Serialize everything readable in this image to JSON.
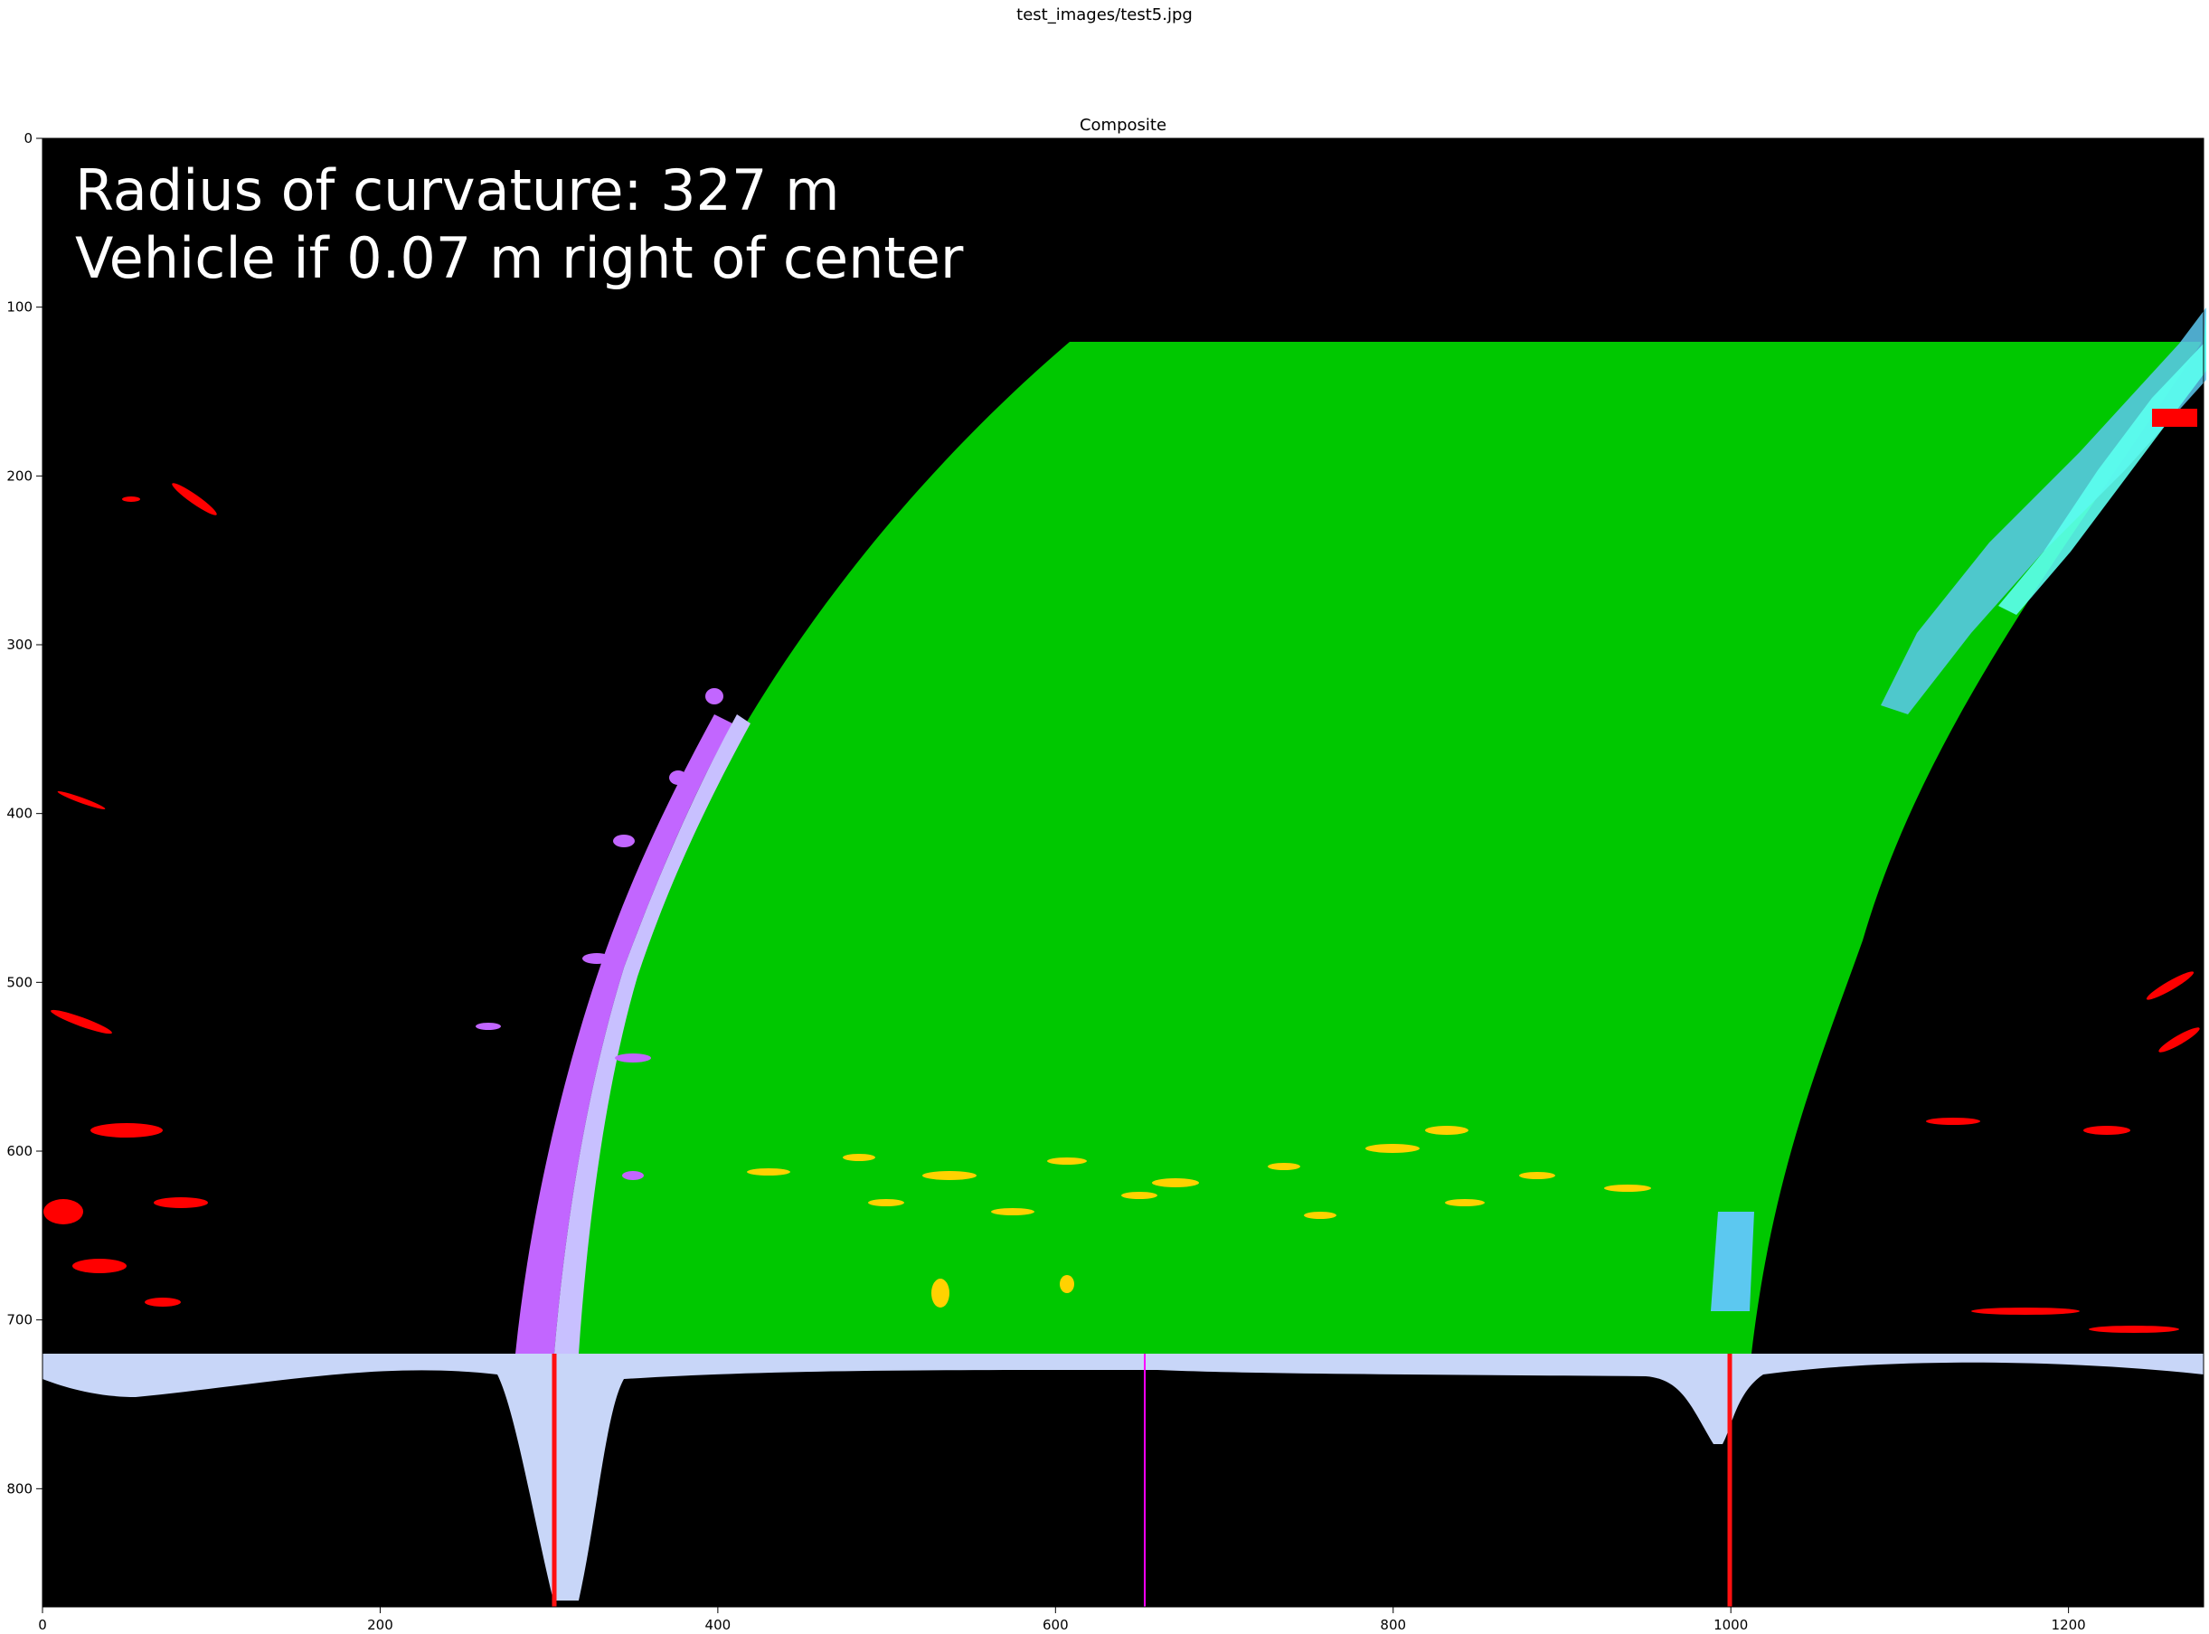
{
  "figure": {
    "suptitle": "test_images/test5.jpg",
    "axes_title": "Composite"
  },
  "overlay": {
    "line1": "Radius of curvature: 327 m",
    "line2": "Vehicle if 0.07 m right of center"
  },
  "axes": {
    "x_ticks": [
      0,
      200,
      400,
      600,
      800,
      1000,
      1200
    ],
    "y_ticks": [
      0,
      100,
      200,
      300,
      400,
      500,
      600,
      700,
      800
    ],
    "x_range": [
      0,
      1280
    ],
    "y_range": [
      0,
      870
    ]
  },
  "lane": {
    "left_peak_x": 304,
    "right_peak_x": 1000,
    "vehicle_center_x": 653,
    "histogram_top_y": 720
  },
  "colors": {
    "background": "#000000",
    "lane_fill": "#00c800",
    "left_lane": "#c266ff",
    "left_lane_light": "#c8c0ff",
    "right_lane": "#5cc8f0",
    "right_lane_cyan": "#5cfff0",
    "yellow_marks": "#ffd200",
    "red_marks": "#ff0000",
    "histogram": "#c8d6f8",
    "peak_marker": "#ff1010",
    "center_marker": "#ff00ff"
  }
}
